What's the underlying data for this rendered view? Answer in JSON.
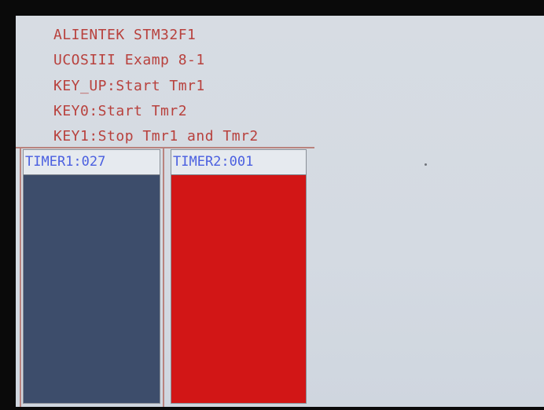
{
  "header": {
    "lines": [
      "ALIENTEK STM32F1",
      "UCOSIII Examp 8-1",
      "KEY_UP:Start Tmr1",
      "KEY0:Start Tmr2",
      "KEY1:Stop Tmr1 and Tmr2"
    ]
  },
  "timers": [
    {
      "label": "TIMER1:027",
      "fill_color": "#3d4d6b"
    },
    {
      "label": "TIMER2:001",
      "fill_color": "#d21616"
    }
  ],
  "colors": {
    "screen_bg": "#d6dbe2",
    "header_text": "#b8413d",
    "timer_label_text": "#4a5fe0",
    "divider": "#b9837e"
  }
}
